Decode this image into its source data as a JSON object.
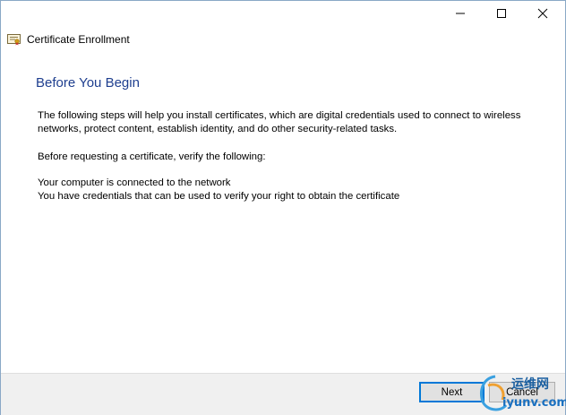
{
  "window": {
    "subtitle": "Certificate Enrollment",
    "controls": [
      "minimize-icon",
      "maximize-icon",
      "close-icon"
    ]
  },
  "main": {
    "heading": "Before You Begin",
    "intro_line1": "The following steps will help you install certificates, which are digital credentials used to connect to wireless",
    "intro_line2": "networks, protect content, establish identity, and do other security-related tasks.",
    "verify_intro": "Before requesting a certificate, verify the following:",
    "requirements": [
      "Your computer is connected to the network",
      "You have credentials that can be used to verify your right to obtain the certificate"
    ]
  },
  "footer": {
    "next_label": "Next",
    "cancel_label": "Cancel"
  },
  "watermark": {
    "cn_text": "运维网",
    "site_text": "iyunv.com"
  },
  "colors": {
    "heading": "#1f3f8f",
    "accent": "#0078d7",
    "footer_bg": "#f0f0f0"
  }
}
